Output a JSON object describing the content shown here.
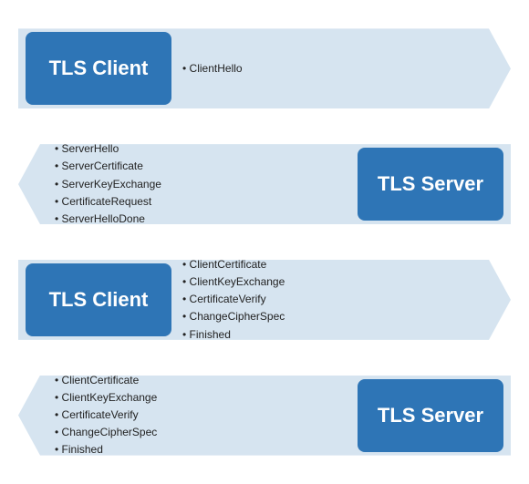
{
  "rows": [
    {
      "id": "row1",
      "direction": "right",
      "box_label": "TLS Client",
      "box_side": "left",
      "messages": [
        "ClientHello"
      ]
    },
    {
      "id": "row2",
      "direction": "left",
      "box_label": "TLS Server",
      "box_side": "right",
      "messages": [
        "ServerHello",
        "ServerCertificate",
        "ServerKeyExchange",
        "CertificateRequest",
        "ServerHelloDone"
      ]
    },
    {
      "id": "row3",
      "direction": "right",
      "box_label": "TLS Client",
      "box_side": "left",
      "messages": [
        "ClientCertificate",
        "ClientKeyExchange",
        "CertificateVerify",
        "ChangeCipherSpec",
        "Finished"
      ]
    },
    {
      "id": "row4",
      "direction": "left",
      "box_label": "TLS Server",
      "box_side": "right",
      "messages": [
        "ClientCertificate",
        "ClientKeyExchange",
        "CertificateVerify",
        "ChangeCipherSpec",
        "Finished"
      ]
    }
  ]
}
